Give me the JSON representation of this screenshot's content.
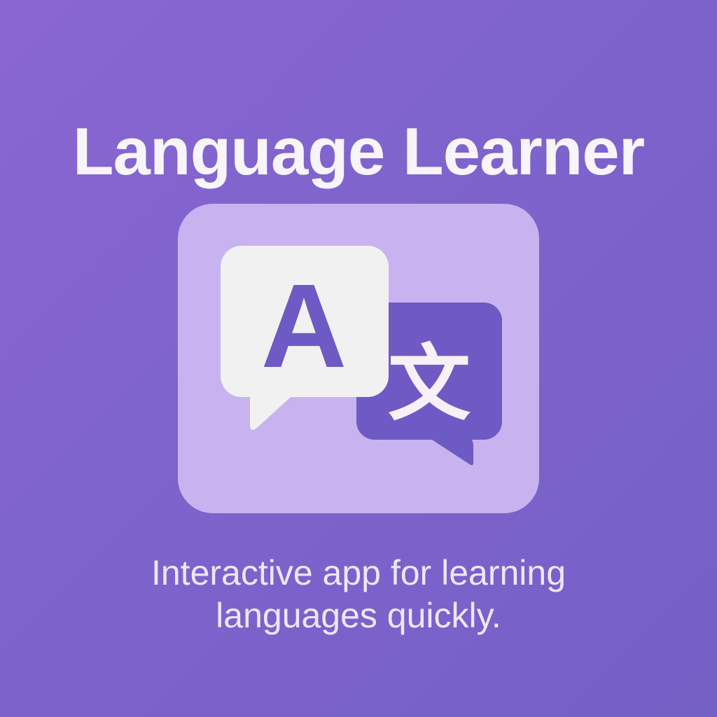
{
  "app": {
    "title": "Language Learner",
    "icon": {
      "name": "translate-icon",
      "left_glyph": "A",
      "right_glyph": "文",
      "colors": {
        "tile": "#c8b3f0",
        "left_bubble": "#f2f1f1",
        "right_bubble": "#6e5ac4",
        "left_glyph": "#6e5ac4",
        "right_glyph": "#f4f2f8"
      }
    },
    "tagline": {
      "line1": "Interactive app for learning",
      "line2": "languages quickly."
    }
  },
  "colors": {
    "background": "#7f63cc",
    "title_text": "#f7f5fb",
    "tagline_text": "#ece6f8"
  }
}
